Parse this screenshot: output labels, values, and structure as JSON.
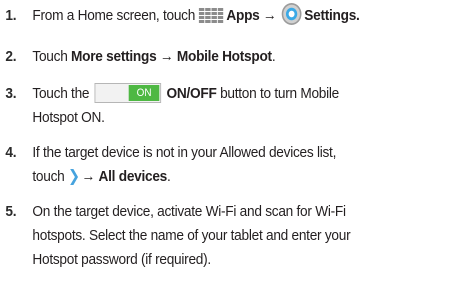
{
  "steps": [
    {
      "number": "1.",
      "text_a": "From a Home screen, touch",
      "apps_label": "Apps",
      "arrow": "→",
      "settings_label": "Settings",
      "period": "."
    },
    {
      "number": "2.",
      "text_a": "Touch",
      "more_settings": "More settings",
      "arrow": "→",
      "mobile_hotspot": "Mobile Hotspot",
      "period": "."
    },
    {
      "number": "3.",
      "text_a": "Touch the",
      "toggle_label": "ON",
      "onoff": "ON/OFF",
      "text_b": "button to turn Mobile",
      "line2": "Hotspot ON."
    },
    {
      "number": "4.",
      "line1": "If the target device is not in your Allowed devices list,",
      "text_a": "touch",
      "arrow": "→",
      "all_devices": "All devices",
      "period": "."
    },
    {
      "number": "5.",
      "line1": "On the target device, activate Wi-Fi and scan for Wi-Fi",
      "line2": "hotspots. Select the name of your tablet and enter your",
      "line3": "Hotspot password (if required)."
    }
  ],
  "icons": {
    "apps": "apps-grid-icon",
    "settings": "gear-icon",
    "toggle": "on-off-toggle",
    "expand": "chevron-right-icon"
  },
  "colors": {
    "toggle_on": "#4eb843",
    "chevron": "#46a3de",
    "gear_accent": "#3ba9e6"
  }
}
